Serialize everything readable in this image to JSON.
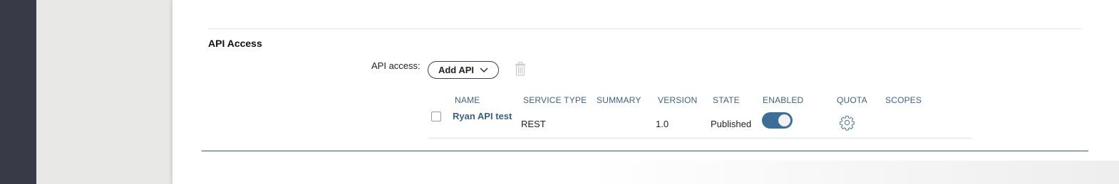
{
  "section": {
    "title": "API Access"
  },
  "field": {
    "label": "API access:"
  },
  "toolbar": {
    "add_api_label": "Add API",
    "delete_icon": "trash-icon"
  },
  "table": {
    "headers": [
      "NAME",
      "SERVICE TYPE",
      "SUMMARY",
      "VERSION",
      "STATE",
      "ENABLED",
      "QUOTA",
      "SCOPES"
    ],
    "rows": [
      {
        "name": "Ryan API test",
        "service_type": "REST",
        "summary": "",
        "version": "1.0",
        "state": "Published",
        "enabled": true,
        "quota_icon": "gear-icon",
        "scopes": ""
      }
    ]
  },
  "colors": {
    "accent": "#3d6e97",
    "link": "#3a5f85",
    "header": "#3e6287",
    "rail": "#383a47"
  }
}
